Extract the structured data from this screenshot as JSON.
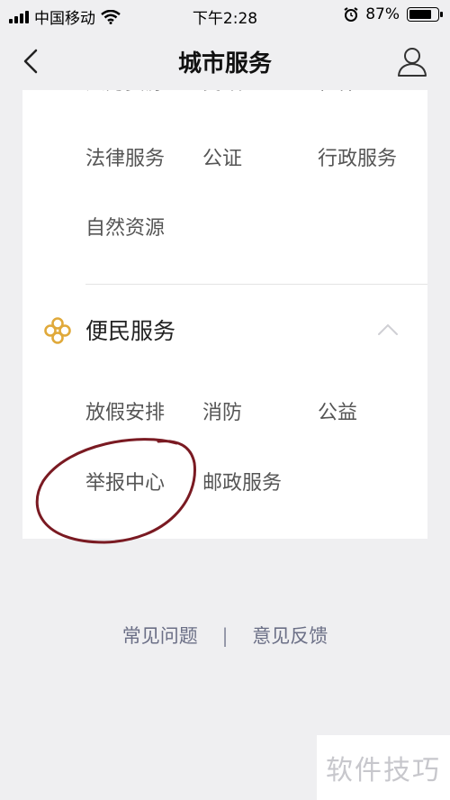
{
  "status_bar": {
    "carrier": "中国移动",
    "time": "下午2:28",
    "battery_percent": "87%",
    "battery_level": 0.87,
    "icons": [
      "signal-icon",
      "wifi-icon",
      "alarm-icon",
      "battery-icon"
    ]
  },
  "nav": {
    "title": "城市服务",
    "back_icon": "chevron-left-icon",
    "profile_icon": "user-icon"
  },
  "top_section": {
    "cut_off_row": [
      "人力资源",
      "民政",
      "社保"
    ],
    "rows": [
      [
        "法律服务",
        "公证",
        "行政服务"
      ],
      [
        "自然资源"
      ]
    ]
  },
  "bianmin_section": {
    "title": "便民服务",
    "icon": "knot-icon",
    "expanded": true,
    "rows": [
      [
        "放假安排",
        "消防",
        "公益"
      ],
      [
        "举报中心",
        "邮政服务"
      ]
    ]
  },
  "footer": {
    "faq": "常见问题",
    "separator": "|",
    "feedback": "意见反馈"
  },
  "watermark": "软件技巧",
  "colors": {
    "background": "#efeff1",
    "card": "#ffffff",
    "accent_icon": "#e0a93a",
    "footer_link": "#6b6f86",
    "annotation": "#7a1a22"
  }
}
